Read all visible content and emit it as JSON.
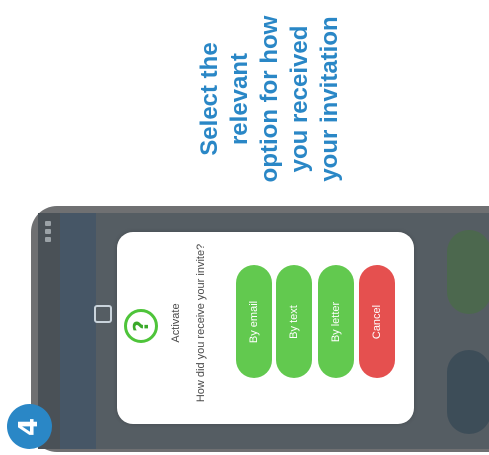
{
  "step": {
    "number": "4"
  },
  "instruction": {
    "lines": [
      "Select the",
      "relevant",
      "option for how",
      "you received",
      "your invitation"
    ]
  },
  "dialog": {
    "title": "Activate",
    "question": "How did you receive your invite?",
    "options": [
      {
        "label": "By email"
      },
      {
        "label": "By text"
      },
      {
        "label": "By letter"
      }
    ],
    "cancel_label": "Cancel"
  },
  "colors": {
    "accent_blue": "#2a87c6",
    "option_green": "#62c94f",
    "cancel_red": "#e5504f",
    "icon_green": "#4ec43a"
  },
  "icons": {
    "dialog_icon": "question-circle-icon"
  }
}
